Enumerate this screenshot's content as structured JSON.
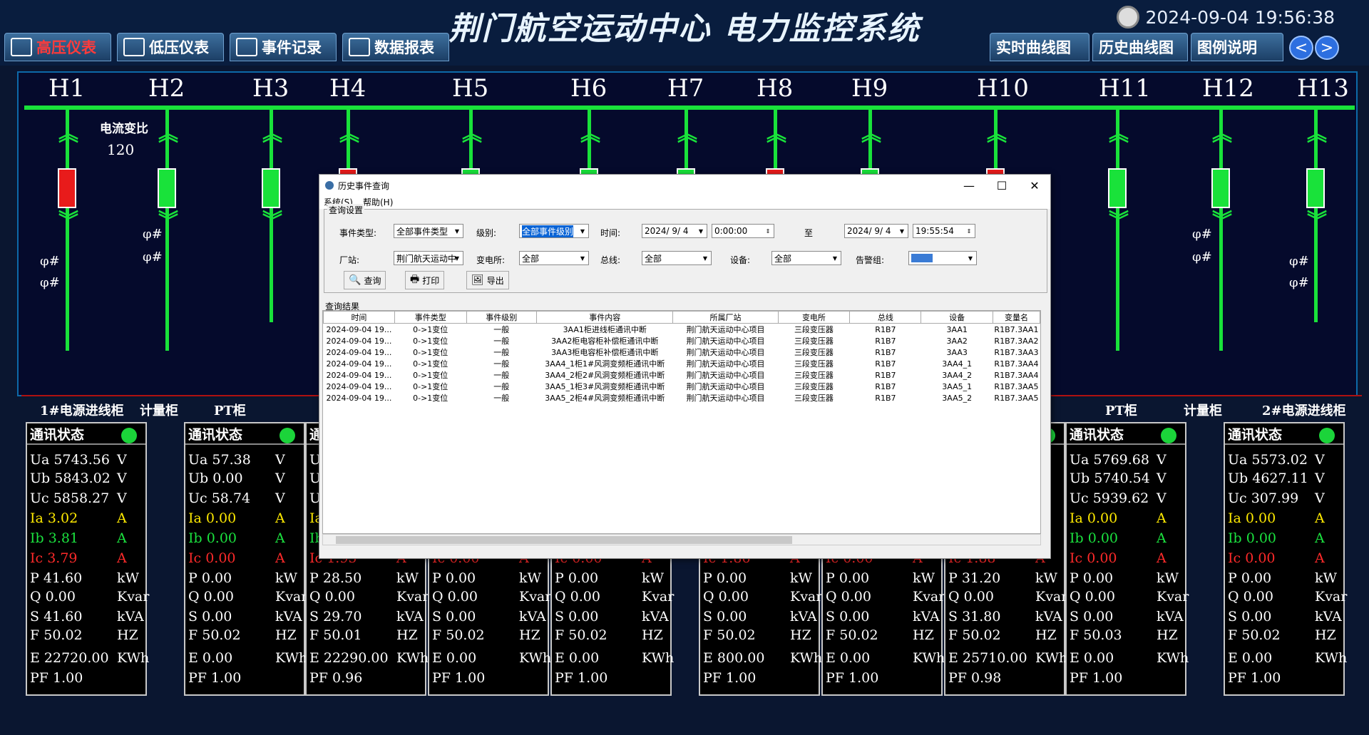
{
  "app": {
    "title": "荆门航空运动中心  电力监控系统",
    "datetime": "2024-09-04  19:56:38"
  },
  "nav_left": [
    {
      "label": "高压仪表",
      "active": true
    },
    {
      "label": "低压仪表"
    },
    {
      "label": "事件记录"
    },
    {
      "label": "数据报表"
    }
  ],
  "nav_right": [
    {
      "label": "实时曲线图"
    },
    {
      "label": "历史曲线图"
    },
    {
      "label": "图例说明"
    }
  ],
  "nav_arrows": {
    "prev": "<",
    "next": ">"
  },
  "circuits": [
    "H1",
    "H2",
    "H3",
    "H4",
    "H5",
    "H6",
    "H7",
    "H8",
    "H9",
    "H10",
    "H11",
    "H12",
    "H13"
  ],
  "diagram": {
    "ct_ratio_label": "电流变比",
    "ct_ratio_value": "120",
    "ct_symbol": "φ#",
    "cabinets_left": [
      "1#电源进线柜",
      "计量柜",
      "PT柜"
    ],
    "cabinets_right": [
      "PT柜",
      "计量柜",
      "2#电源进线柜"
    ]
  },
  "meter_labels": [
    "Ua",
    "Ub",
    "Uc",
    "Ia",
    "Ib",
    "Ic",
    "P",
    "Q",
    "S",
    "F",
    "E",
    "PF"
  ],
  "meter_units": [
    "V",
    "V",
    "V",
    "A",
    "A",
    "A",
    "kW",
    "Kvar",
    "kVA",
    "HZ",
    "KWh",
    ""
  ],
  "meter_panel_title": "通讯状态",
  "meters": [
    {
      "Ua": "5743.56",
      "Ub": "5843.02",
      "Uc": "5858.27",
      "Ia": "3.02",
      "Ib": "3.81",
      "Ic": "3.79",
      "P": "41.60",
      "Q": "0.00",
      "S": "41.60",
      "F": "50.02",
      "E": "22720.00",
      "PF": "1.00"
    },
    {
      "Ua": "57.38",
      "Ub": "0.00",
      "Uc": "58.74",
      "Ia": "0.00",
      "Ib": "0.00",
      "Ic": "0.00",
      "P": "0.00",
      "Q": "0.00",
      "S": "0.00",
      "F": "50.02",
      "E": "0.00",
      "PF": "1.00"
    },
    {
      "Ua": "",
      "Ub": "",
      "Uc": "",
      "Ia": "",
      "Ib": "",
      "Ic": "1.95",
      "P": "28.50",
      "Q": "0.00",
      "S": "29.70",
      "F": "50.01",
      "E": "22290.00",
      "PF": "0.96"
    },
    {
      "Ua": "",
      "Ub": "",
      "Uc": "",
      "Ia": "",
      "Ib": "",
      "Ic": "0.00",
      "P": "0.00",
      "Q": "0.00",
      "S": "0.00",
      "F": "50.02",
      "E": "0.00",
      "PF": "1.00"
    },
    {
      "Ua": "",
      "Ub": "",
      "Uc": "",
      "Ia": "",
      "Ib": "",
      "Ic": "0.00",
      "P": "0.00",
      "Q": "0.00",
      "S": "0.00",
      "F": "50.02",
      "E": "0.00",
      "PF": "1.00"
    },
    {
      "Ua": "",
      "Ub": "",
      "Uc": "",
      "Ia": "",
      "Ib": "",
      "Ic": "1.86",
      "P": "0.00",
      "Q": "0.00",
      "S": "0.00",
      "F": "50.02",
      "E": "800.00",
      "PF": "1.00"
    },
    {
      "Ua": "",
      "Ub": "",
      "Uc": "",
      "Ia": "",
      "Ib": "",
      "Ic": "0.00",
      "P": "0.00",
      "Q": "0.00",
      "S": "0.00",
      "F": "50.02",
      "E": "0.00",
      "PF": "1.00"
    },
    {
      "Ua": "",
      "Ub": "",
      "Uc": "",
      "Ia": "",
      "Ib": "",
      "Ic": "1.88",
      "P": "31.20",
      "Q": "0.00",
      "S": "31.80",
      "F": "50.02",
      "E": "25710.00",
      "PF": "0.98"
    },
    {
      "Ua": "5769.68",
      "Ub": "5740.54",
      "Uc": "5939.62",
      "Ia": "0.00",
      "Ib": "0.00",
      "Ic": "0.00",
      "P": "0.00",
      "Q": "0.00",
      "S": "0.00",
      "F": "50.03",
      "E": "0.00",
      "PF": "1.00"
    },
    {
      "Ua": "5573.02",
      "Ub": "4627.11",
      "Uc": "307.99",
      "Ia": "0.00",
      "Ib": "0.00",
      "Ic": "0.00",
      "P": "0.00",
      "Q": "0.00",
      "S": "0.00",
      "F": "50.02",
      "E": "0.00",
      "PF": "1.00"
    }
  ],
  "dialog": {
    "title": "历史事件查询",
    "menu": [
      "系统(S)",
      "帮助(H)"
    ],
    "group_query": "查询设置",
    "labels": {
      "event_type": "事件类型:",
      "level": "级别:",
      "time": "时间:",
      "to": "至",
      "station": "厂站:",
      "substation": "变电所:",
      "bus": "总线:",
      "device": "设备:",
      "alarm_group": "告警组:"
    },
    "values": {
      "event_type": "全部事件类型",
      "level": "全部事件级别",
      "date_from": "2024/ 9/ 4",
      "time_from": "0:00:00",
      "date_to": "2024/ 9/ 4",
      "time_to": "19:55:54",
      "station": "荆门航天运动中",
      "substation": "全部",
      "bus": "全部",
      "device": "全部",
      "alarm_group": ""
    },
    "buttons": [
      "查询",
      "打印",
      "导出"
    ],
    "window_controls": {
      "minimize": "—",
      "maximize": "☐",
      "close": "✕"
    },
    "group_result": "查询结果",
    "columns": [
      "时间",
      "事件类型",
      "事件级别",
      "事件内容",
      "所属厂站",
      "变电所",
      "总线",
      "设备",
      "变量名"
    ],
    "rows": [
      [
        "2024-09-04 19...",
        "0->1变位",
        "一般",
        "3AA1柜进线柜通讯中断",
        "荆门航天运动中心项目",
        "三段变压器",
        "R1B7",
        "3AA1",
        "R1B7.3AA1"
      ],
      [
        "2024-09-04 19...",
        "0->1变位",
        "一般",
        "3AA2柜电容柜补偿柜通讯中断",
        "荆门航天运动中心项目",
        "三段变压器",
        "R1B7",
        "3AA2",
        "R1B7.3AA2"
      ],
      [
        "2024-09-04 19...",
        "0->1变位",
        "一般",
        "3AA3柜电容柜补偿柜通讯中断",
        "荆门航天运动中心项目",
        "三段变压器",
        "R1B7",
        "3AA3",
        "R1B7.3AA3"
      ],
      [
        "2024-09-04 19...",
        "0->1变位",
        "一般",
        "3AA4_1柜1#风洞变频柜通讯中断",
        "荆门航天运动中心项目",
        "三段变压器",
        "R1B7",
        "3AA4_1",
        "R1B7.3AA4"
      ],
      [
        "2024-09-04 19...",
        "0->1变位",
        "一般",
        "3AA4_2柜2#风洞变频柜通讯中断",
        "荆门航天运动中心项目",
        "三段变压器",
        "R1B7",
        "3AA4_2",
        "R1B7.3AA4"
      ],
      [
        "2024-09-04 19...",
        "0->1变位",
        "一般",
        "3AA5_1柜3#风洞变频柜通讯中断",
        "荆门航天运动中心项目",
        "三段变压器",
        "R1B7",
        "3AA5_1",
        "R1B7.3AA5"
      ],
      [
        "2024-09-04 19...",
        "0->1变位",
        "一般",
        "3AA5_2柜4#风洞变频柜通讯中断",
        "荆门航天运动中心项目",
        "三段变压器",
        "R1B7",
        "3AA5_2",
        "R1B7.3AA5"
      ]
    ]
  },
  "colors": {
    "bus": "#19e23a",
    "breaker_closed": "#19e23a",
    "breaker_open": "#e81b1b",
    "background": "#0a1630",
    "status_ok": "#1bd43a"
  }
}
